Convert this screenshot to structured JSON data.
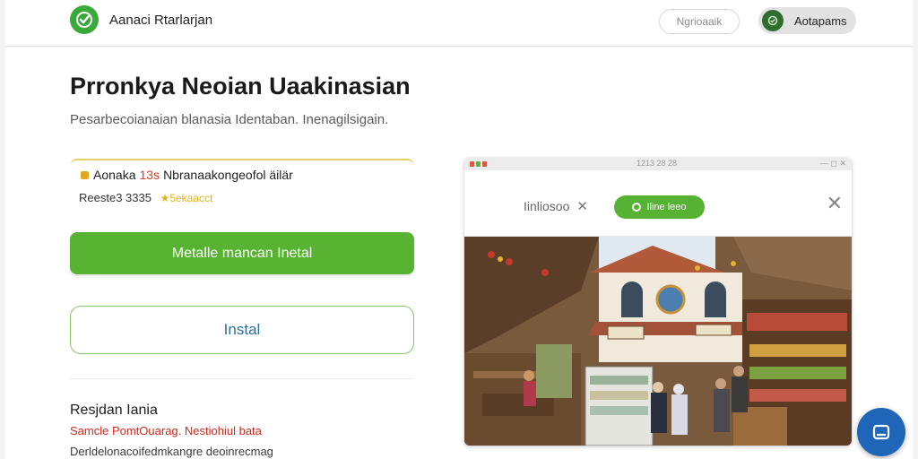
{
  "header": {
    "brand": "Aanaci Rtarlarjan",
    "link_label": "Ngrioaaik",
    "account_label": "Aotapams"
  },
  "main": {
    "title": "Prronkya Neoian Uaakinasian",
    "subtitle": "Pesarbecoianaian blanasia Identaban. Inenagilsigain.",
    "notice": {
      "app": "Aonaka",
      "tag": "13s",
      "text": "Nbranaakongeofol äilär",
      "meta": "Reeste3 3335",
      "rating_text": "★5ekaacct"
    },
    "primary_button": "Metalle mancan Inetal",
    "secondary_button": "Instal",
    "section_title": "Resjdan Iania",
    "section_warning": "Samcle PomtOuarag. Nestiohiul bata",
    "section_text": "Derldelonacoifedmkangre deoinrecmag"
  },
  "preview": {
    "window_title": "1213  28 28",
    "window_controls": "— ◻ ✕",
    "toolbar_label": "Iinliosoo",
    "pill_label": "Iline leeo"
  },
  "colors": {
    "brand_green": "#3aa93a",
    "button_green": "#57b331",
    "link_blue": "#2f6f9a",
    "warning_red": "#d2281e",
    "fab_blue": "#1f66b8"
  },
  "icons": [
    "check-logo-icon",
    "account-icon",
    "warning-icon",
    "star-icon",
    "close-icon",
    "chat-icon"
  ]
}
